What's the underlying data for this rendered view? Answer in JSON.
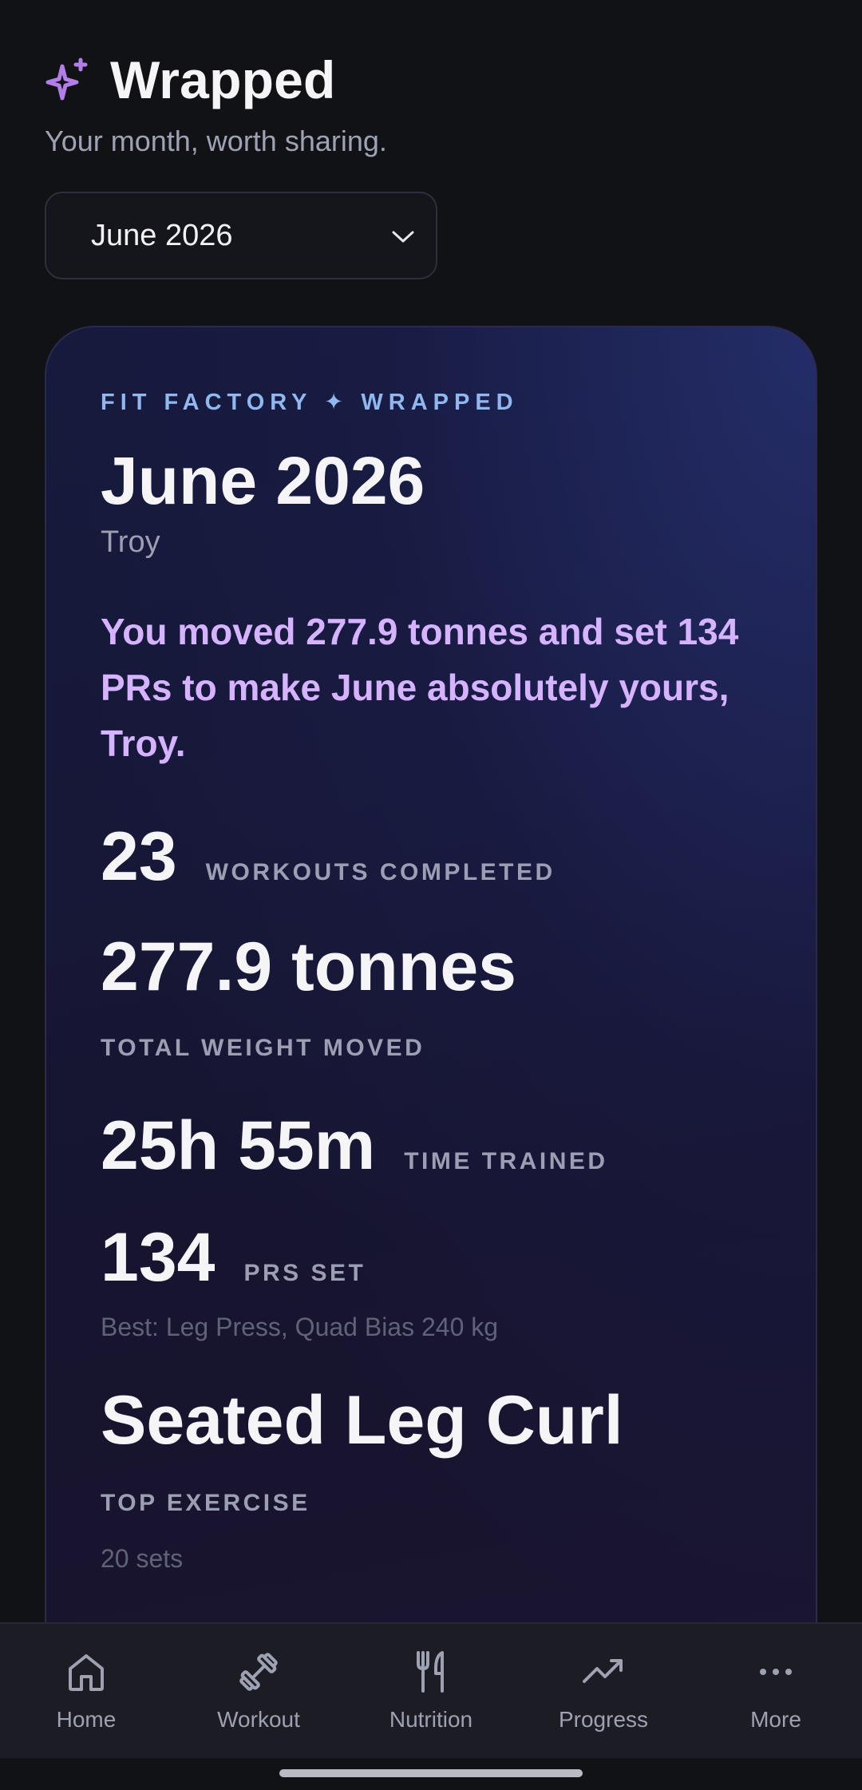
{
  "header": {
    "title": "Wrapped",
    "subtitle": "Your month, worth sharing.",
    "icon": "sparkle-icon"
  },
  "month_select": {
    "value": "June 2026"
  },
  "card": {
    "eyebrow": "FIT FACTORY ✦ WRAPPED",
    "month": "June 2026",
    "user": "Troy",
    "headline": "You moved 277.9 tonnes and set 134 PRs to make June absolutely yours, Troy.",
    "workouts": {
      "value": "23",
      "label": "WORKOUTS COMPLETED"
    },
    "weight": {
      "value": "277.9 tonnes",
      "label": "TOTAL WEIGHT MOVED"
    },
    "time": {
      "value": "25h 55m",
      "label": "TIME TRAINED"
    },
    "prs": {
      "value": "134",
      "label": "PRS SET",
      "note": "Best: Leg Press, Quad Bias 240 kg"
    },
    "top_exercise": {
      "value": "Seated Leg Curl",
      "label": "TOP EXERCISE",
      "note": "20 sets"
    }
  },
  "nav": {
    "items": [
      {
        "label": "Home",
        "icon": "home-icon"
      },
      {
        "label": "Workout",
        "icon": "dumbbell-icon"
      },
      {
        "label": "Nutrition",
        "icon": "fork-knife-icon"
      },
      {
        "label": "Progress",
        "icon": "trending-up-icon"
      },
      {
        "label": "More",
        "icon": "more-dots-icon"
      }
    ]
  },
  "colors": {
    "background": "#111216",
    "accent_purple": "#d6b3ff",
    "eyebrow_blue": "#8fb8f0",
    "sparkle": "#b27ee8"
  }
}
